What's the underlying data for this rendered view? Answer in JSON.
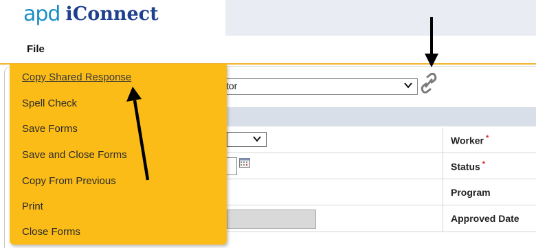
{
  "app": {
    "logo_part1": "apd",
    "logo_part2": "iConnect"
  },
  "menubar": {
    "file_label": "File"
  },
  "file_menu": {
    "items": [
      {
        "label": "Copy Shared Response"
      },
      {
        "label": "Spell Check"
      },
      {
        "label": "Save Forms"
      },
      {
        "label": "Save and Close Forms"
      },
      {
        "label": "Copy From Previous"
      },
      {
        "label": "Print"
      },
      {
        "label": "Close Forms"
      }
    ]
  },
  "form": {
    "main_select_value": "tor",
    "fields": {
      "worker_label": "Worker",
      "status_label": "Status",
      "program_label": "Program",
      "approved_date_label": "Approved Date",
      "required_marker": "*"
    }
  },
  "icons": {
    "link": "link-icon",
    "calendar": "calendar-icon",
    "dropdown": "chevron-down-icon"
  },
  "colors": {
    "menu_background": "#fcbc18",
    "accent_line": "#f2b32a",
    "logo_blue": "#1c8fc8",
    "logo_navy": "#1f3f8f",
    "required": "#e02020"
  }
}
